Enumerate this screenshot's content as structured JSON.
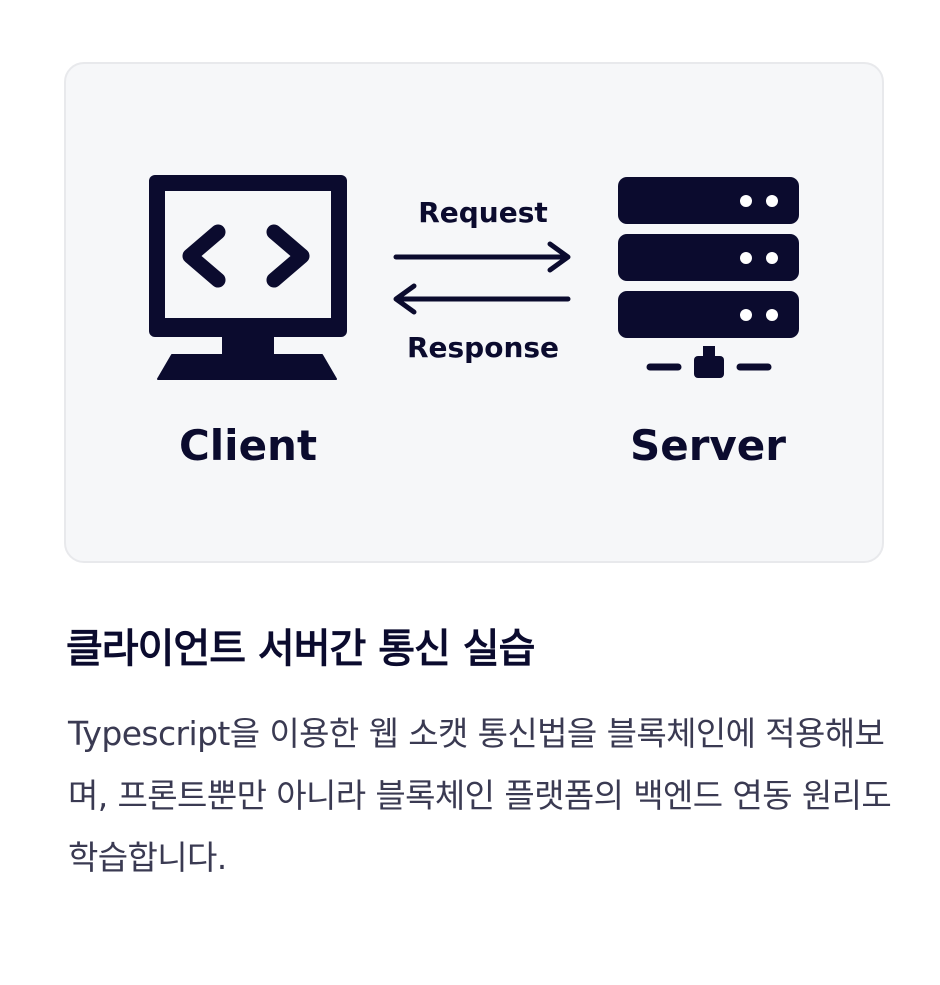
{
  "diagram": {
    "client_label": "Client",
    "server_label": "Server",
    "request_label": "Request",
    "response_label": "Response"
  },
  "content": {
    "title": "클라이언트 서버간 통신 실습",
    "description": "Typescript을 이용한 웹 소캣 통신법을 블록체인에 적용해보며, 프론트뿐만 아니라 블록체인 플랫폼의 백엔드 연동 원리도 학습합니다."
  },
  "colors": {
    "ink": "#0b0b2e",
    "card_bg": "#f6f7f9",
    "card_border": "#e8e9ec",
    "body_text": "#3a3a52"
  },
  "icons": [
    "monitor-code-icon",
    "server-rack-icon",
    "arrow-right-icon",
    "arrow-left-icon"
  ]
}
